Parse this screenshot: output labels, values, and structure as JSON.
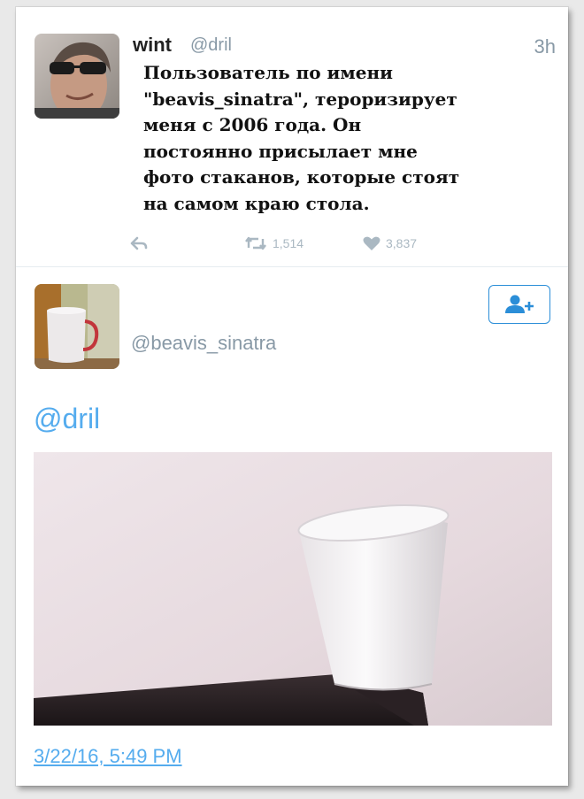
{
  "tweet": {
    "author_name": "wint",
    "author_handle": "@dril",
    "time": "3h",
    "text": "Пользователь по имени\n\"beavis_sinatra\", тероризирует\nменя с 2006 года. Он\nпостоянно присылает мне\nфото стаканов, которые стоят\nна самом краю стола.",
    "retweets": "1,514",
    "likes": "3,837"
  },
  "reply": {
    "handle": "@beavis_sinatra",
    "mention": "@dril",
    "timestamp": "3/22/16, 5:49 PM",
    "accent": "#55acee"
  },
  "icons": [
    "reply-icon",
    "retweet-icon",
    "heart-icon",
    "follow-user-icon"
  ]
}
